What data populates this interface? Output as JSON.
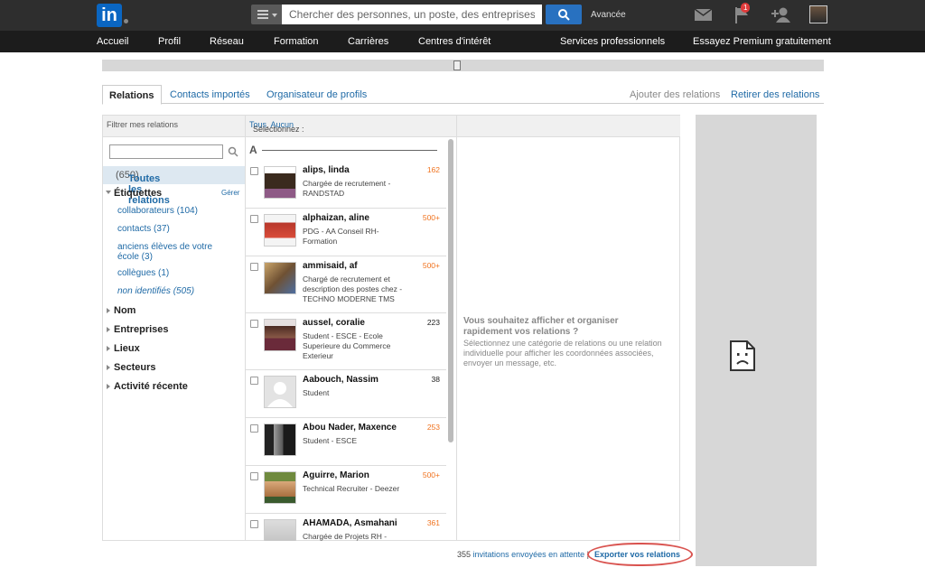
{
  "header": {
    "logo_text": "in",
    "search": {
      "placeholder": "Chercher des personnes, un poste, des entreprises..."
    },
    "advanced_label": "Avancée",
    "notification_count": "1"
  },
  "nav": {
    "items": [
      "Accueil",
      "Profil",
      "Réseau",
      "Formation",
      "Carrières",
      "Centres d'intérêt",
      "Services professionnels",
      "Essayez Premium gratuitement"
    ]
  },
  "tabs": {
    "active": "Relations",
    "imported": "Contacts importés",
    "organizer": "Organisateur de profils",
    "add": "Ajouter des relations",
    "remove": "Retirer des relations"
  },
  "left_panel": {
    "header": "Filtrer mes relations",
    "all_relations": "Toutes les relations",
    "all_relations_count": "(650)",
    "tags_title": "Étiquettes",
    "manage": "Gérer",
    "tags": [
      "collaborateurs (104)",
      "contacts (37)",
      "anciens élèves de votre école (3)",
      "collègues (1)",
      "non identifiés (505)"
    ],
    "sections": [
      "Nom",
      "Entreprises",
      "Lieux",
      "Secteurs",
      "Activité récente"
    ]
  },
  "mid_panel": {
    "select_label": "Sélectionnez : ",
    "select_all": "Tous",
    "select_none": "Aucun",
    "letter": "A",
    "contacts": [
      {
        "name": "alips, linda",
        "title": "Chargée de recrutement - RANDSTAD",
        "count": "162"
      },
      {
        "name": "alphaizan, aline",
        "title": "PDG - AA Conseil RH-Formation",
        "count": "500+"
      },
      {
        "name": "ammisaid, af",
        "title": "Chargé de recrutement et description des postes chez - TECHNO MODERNE TMS",
        "count": "500+"
      },
      {
        "name": "aussel, coralie",
        "title": "Student - ESCE - Ecole Superieure du Commerce Exterieur",
        "count": "223"
      },
      {
        "name": "Aabouch, Nassim",
        "title": "Student",
        "count": "38"
      },
      {
        "name": "Abou Nader, Maxence",
        "title": "Student - ESCE",
        "count": "253"
      },
      {
        "name": "Aguirre, Marion",
        "title": "Technical Recruiter - Deezer",
        "count": "500+"
      },
      {
        "name": "AHAMADA, Asmahani",
        "title": "Chargée de Projets RH -",
        "count": "361"
      }
    ]
  },
  "right_panel": {
    "title": "Vous souhaitez afficher et organiser rapidement vos relations ?",
    "text": "Sélectionnez une catégorie de relations ou une relation individuelle pour afficher les coordonnées associées, envoyer un message, etc."
  },
  "footer": {
    "count": "355",
    "invitations": "invitations envoyées en attente",
    "separator": "|",
    "export": "Exporter vos relations"
  }
}
